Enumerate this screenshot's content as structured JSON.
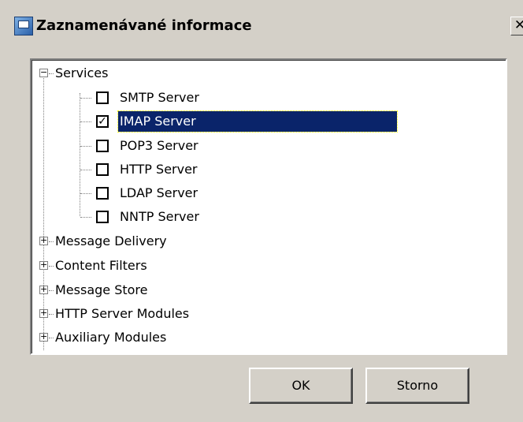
{
  "window": {
    "title": "Zaznamenávané informace",
    "close_label": "✕"
  },
  "tree": {
    "root": {
      "label": "Services",
      "expanded": true
    },
    "services": [
      {
        "label": "SMTP Server",
        "checked": false,
        "selected": false
      },
      {
        "label": "IMAP Server",
        "checked": true,
        "selected": true
      },
      {
        "label": "POP3 Server",
        "checked": false,
        "selected": false
      },
      {
        "label": "HTTP Server",
        "checked": false,
        "selected": false
      },
      {
        "label": "LDAP Server",
        "checked": false,
        "selected": false
      },
      {
        "label": "NNTP Server",
        "checked": false,
        "selected": false
      }
    ],
    "groups": [
      {
        "label": "Message Delivery",
        "expanded": false
      },
      {
        "label": "Content Filters",
        "expanded": false
      },
      {
        "label": "Message Store",
        "expanded": false
      },
      {
        "label": "HTTP Server Modules",
        "expanded": false
      },
      {
        "label": "Auxiliary Modules",
        "expanded": false
      }
    ]
  },
  "buttons": {
    "ok": "OK",
    "cancel": "Storno"
  },
  "colors": {
    "selection": "#0a246a",
    "face": "#d4d0c8"
  }
}
